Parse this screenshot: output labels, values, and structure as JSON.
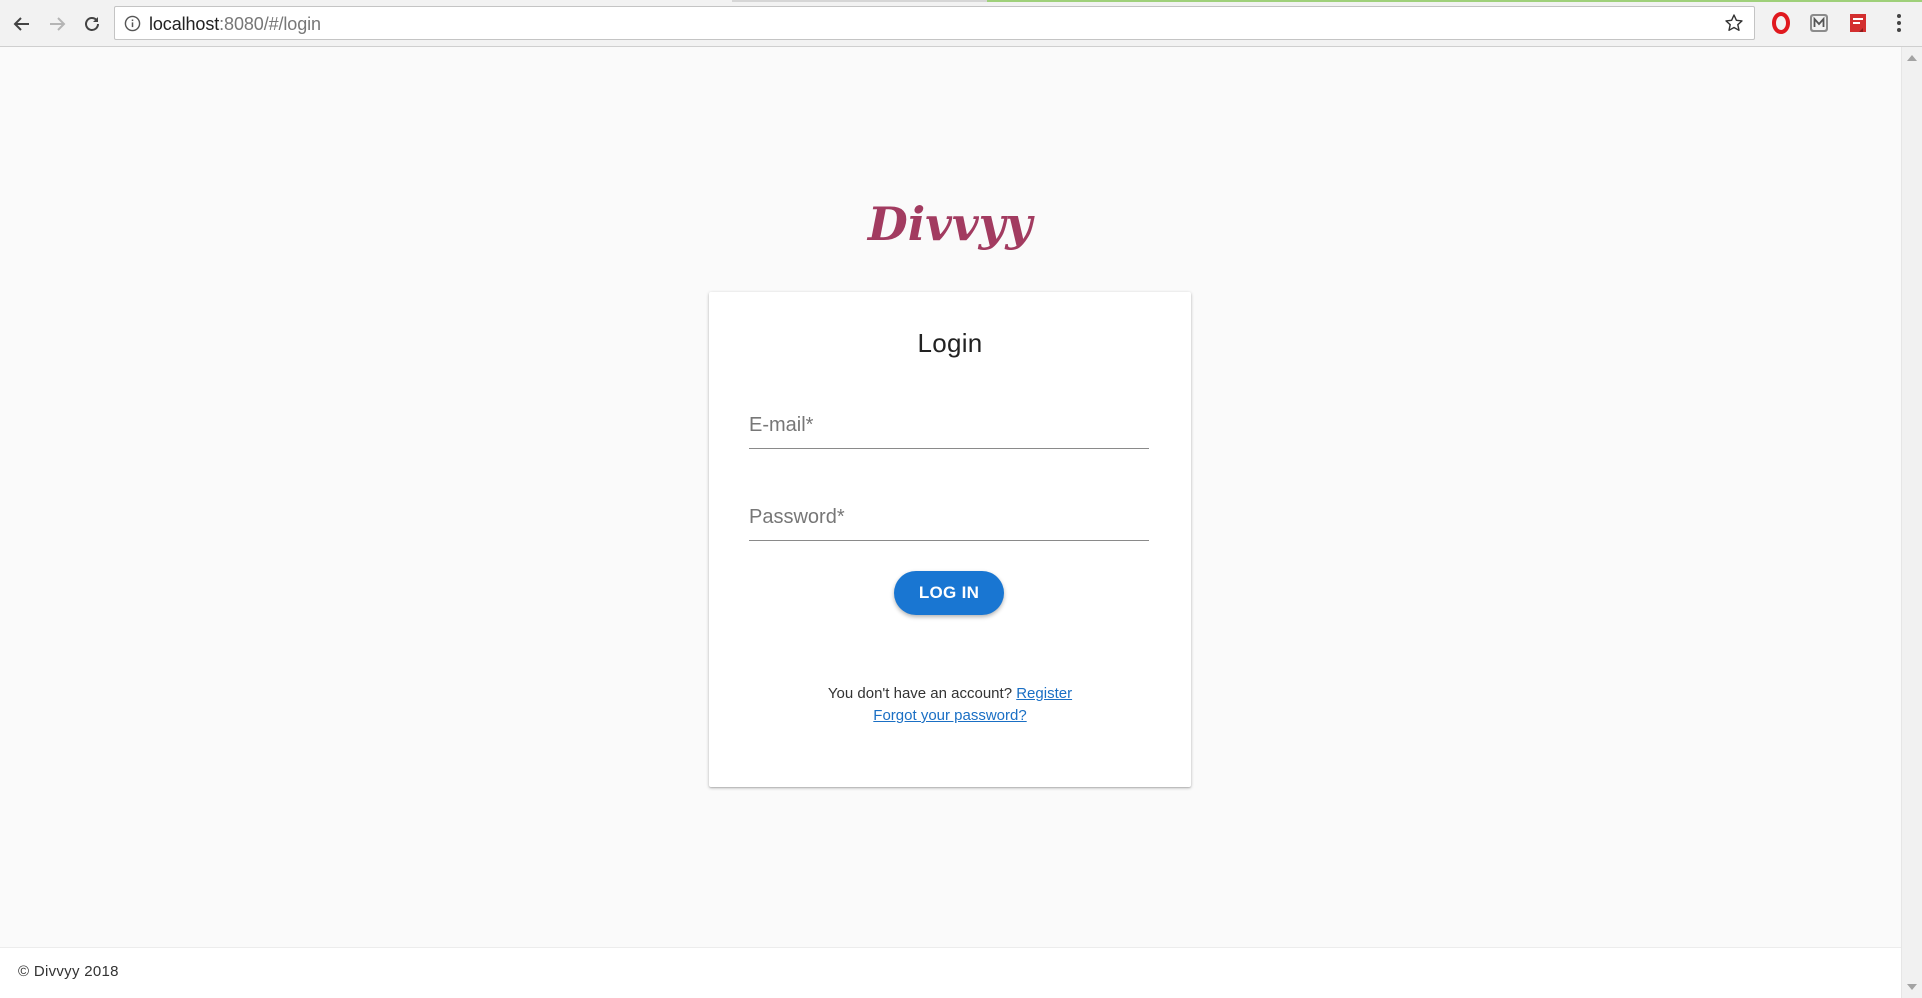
{
  "browser": {
    "url_host": "localhost",
    "url_rest": ":8080/#/login",
    "icons": {
      "back": "arrow-left-icon",
      "forward": "arrow-right-icon",
      "reload": "reload-icon",
      "info": "info-icon",
      "bookmark": "star-icon",
      "menu": "three-dots-icon"
    },
    "extensions": [
      "opera-icon",
      "extension-m-icon",
      "pdf-icon"
    ]
  },
  "logo": {
    "text": "Divvyy",
    "color": "#a23b60"
  },
  "login_card": {
    "title": "Login",
    "email_placeholder": "E-mail*",
    "email_value": "",
    "password_placeholder": "Password*",
    "password_value": "",
    "submit_label": "LOG IN",
    "no_account_text": "You don't have an account?",
    "register_link": "Register",
    "forgot_link": "Forgot your password?"
  },
  "footer": {
    "copyright": "© Divvyy 2018"
  },
  "colors": {
    "primary": "#1976d2",
    "link": "#1a6fc4",
    "background": "#fafafa"
  }
}
